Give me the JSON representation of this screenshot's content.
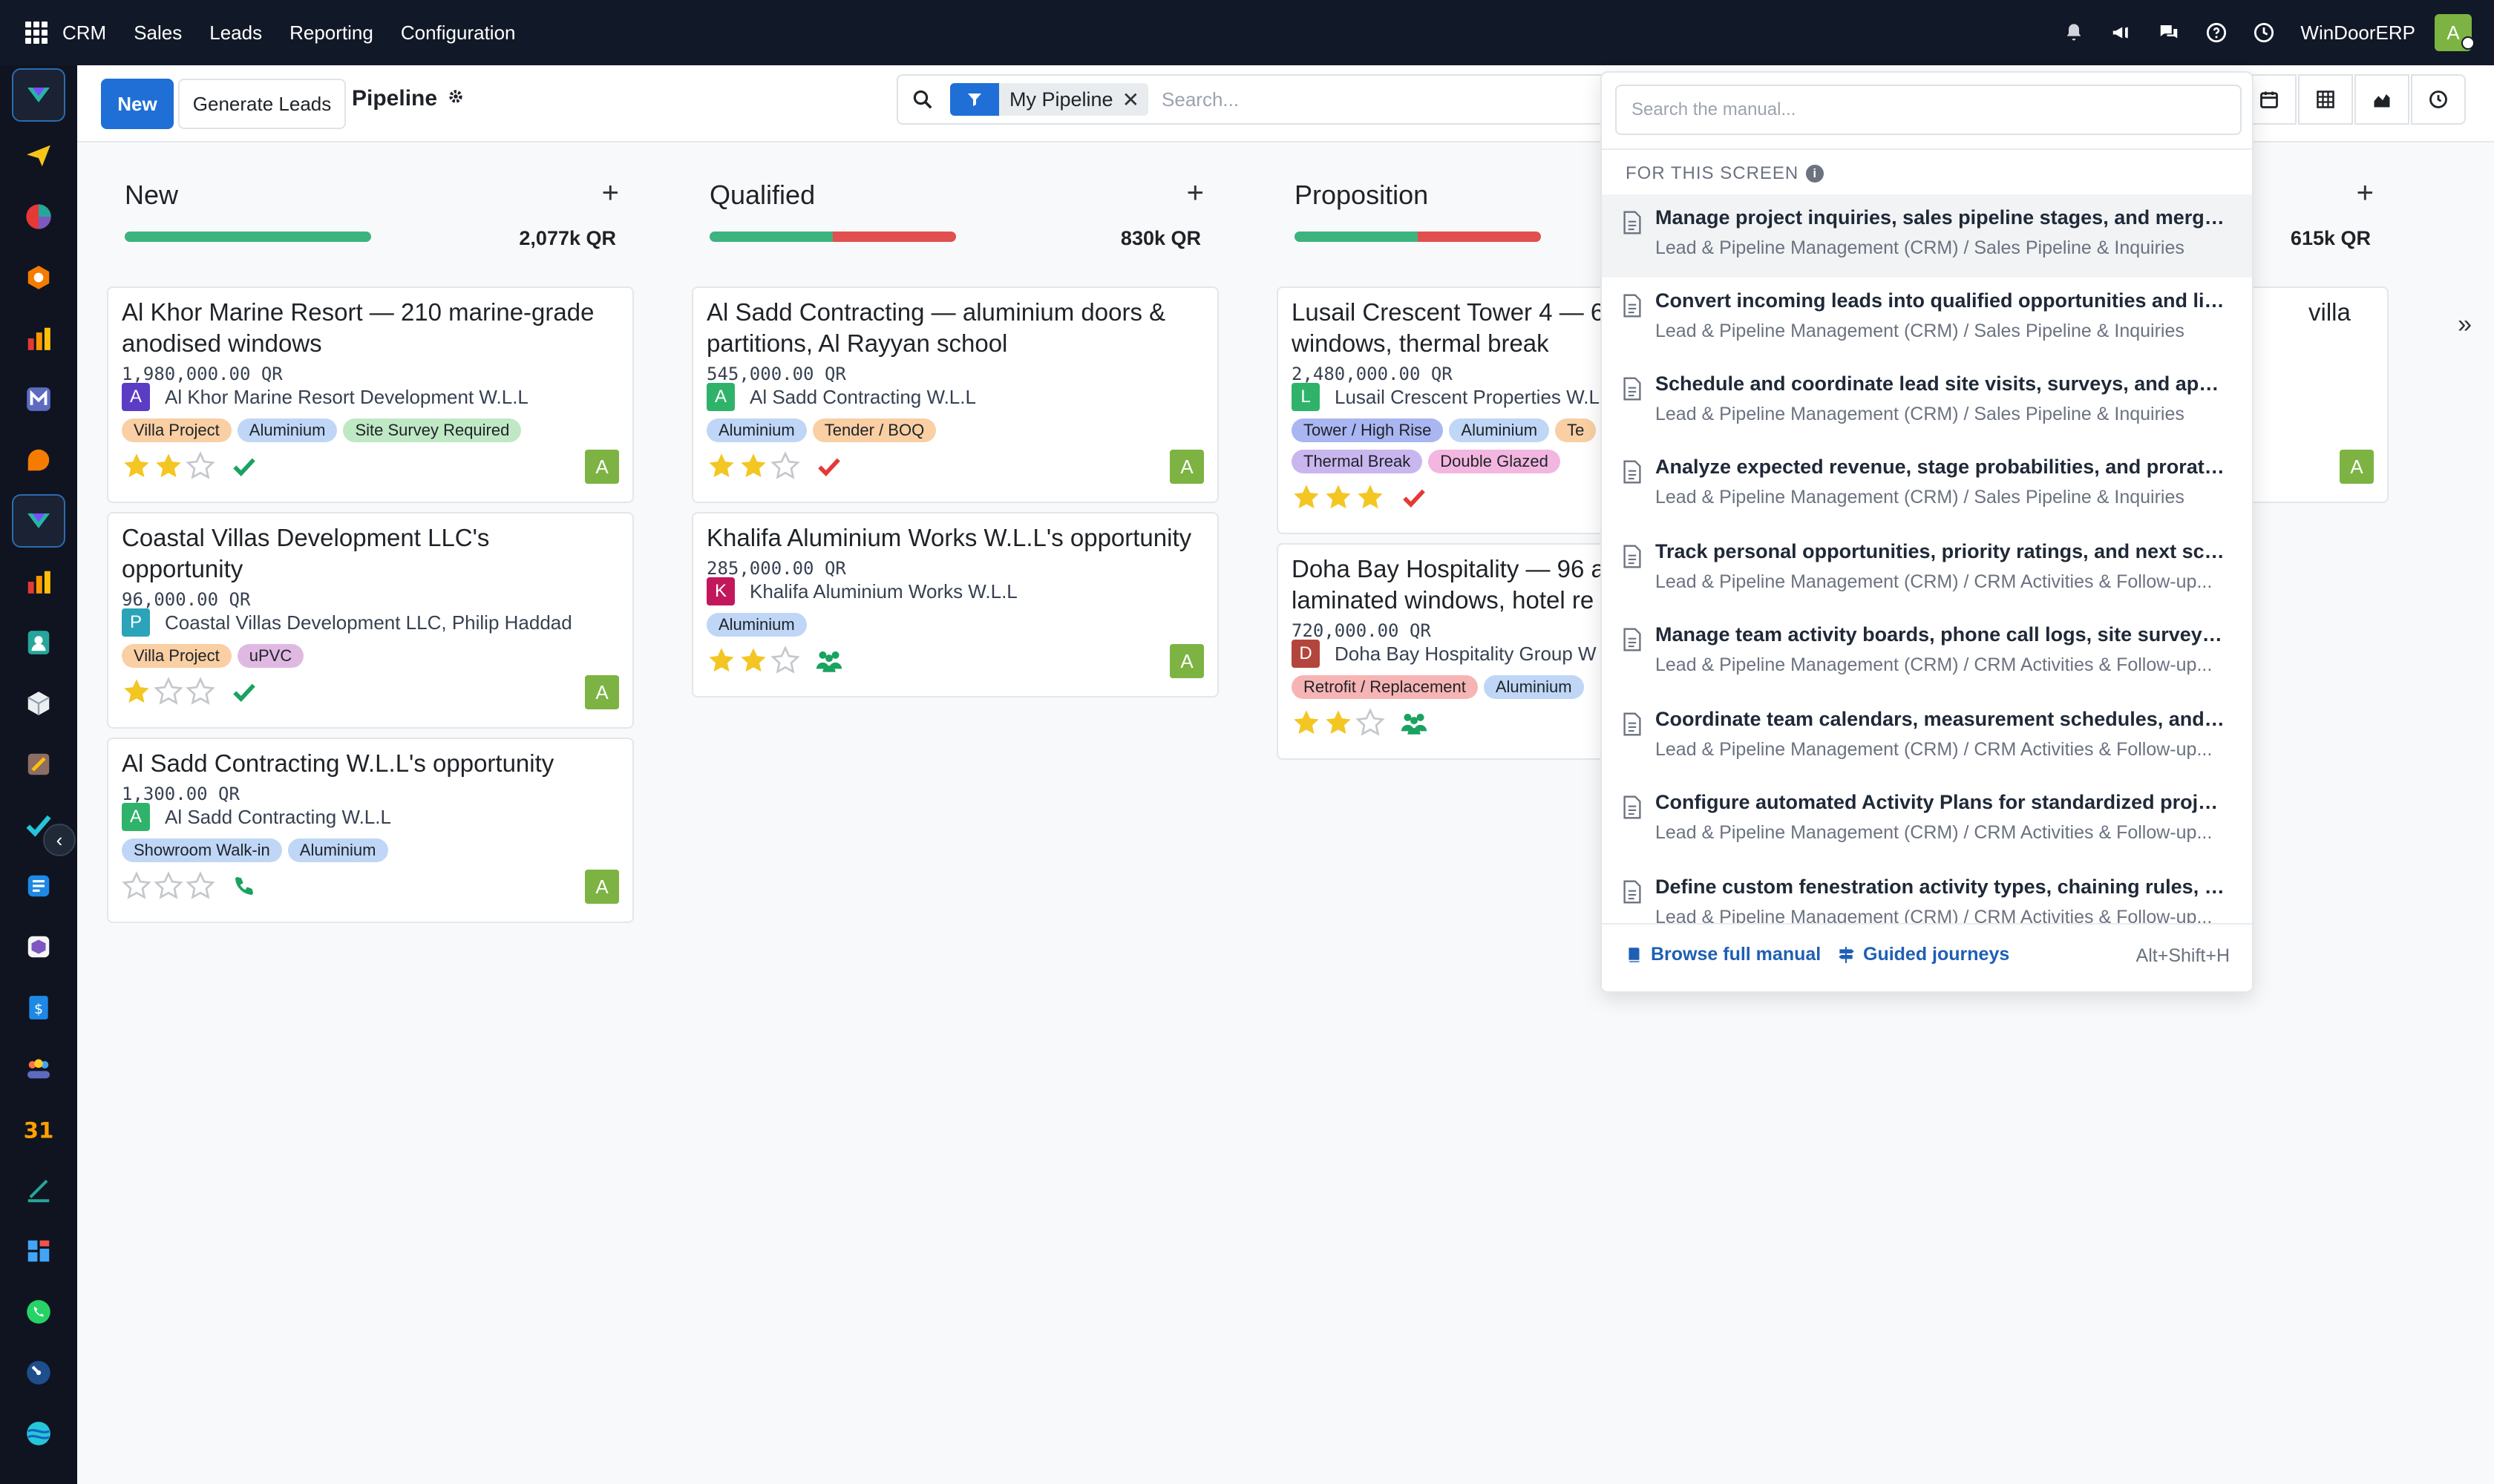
{
  "topbar": {
    "menu": [
      "CRM",
      "Sales",
      "Leads",
      "Reporting",
      "Configuration"
    ],
    "company": "WinDoorERP",
    "user_initial": "A",
    "icons": [
      "bell-icon",
      "megaphone-icon",
      "chat-icon",
      "help-icon",
      "clock-icon"
    ]
  },
  "control": {
    "new_label": "New",
    "generate_label": "Generate Leads",
    "title": "Pipeline",
    "filter_label": "My Pipeline",
    "search_placeholder": "Search..."
  },
  "columns": [
    {
      "name": "New",
      "amount": "2,077k QR",
      "bar": {
        "green": 1.0,
        "red": 0
      },
      "cards": [
        {
          "title": "Al Khor Marine Resort — 210 marine-grade anodised windows",
          "revenue": "1,980,000.00 QR",
          "partner": "Al Khor Marine Resort Development W.L.L",
          "partner_initial": "A",
          "partner_color": "#5b3cc4",
          "tags": [
            {
              "label": "Villa Project",
              "color": "#f9cfa3"
            },
            {
              "label": "Aluminium",
              "color": "#bfd6f6"
            },
            {
              "label": "Site Survey Required",
              "color": "#bfe8c4"
            }
          ],
          "stars": 2,
          "activity": "check-green",
          "avatar": "A"
        },
        {
          "title": "Coastal Villas Development LLC's opportunity",
          "revenue": "96,000.00 QR",
          "partner": "Coastal Villas Development LLC, Philip Haddad",
          "partner_initial": "P",
          "partner_color": "#2ba3b8",
          "tags": [
            {
              "label": "Villa Project",
              "color": "#f9cfa3"
            },
            {
              "label": "uPVC",
              "color": "#e0b9e3"
            }
          ],
          "stars": 1,
          "activity": "check-green",
          "avatar": "A"
        },
        {
          "title": "Al Sadd Contracting W.L.L's opportunity",
          "revenue": "1,300.00 QR",
          "partner": "Al Sadd Contracting W.L.L",
          "partner_initial": "A",
          "partner_color": "#2fb36b",
          "tags": [
            {
              "label": "Showroom Walk-in",
              "color": "#bfd6f6"
            },
            {
              "label": "Aluminium",
              "color": "#bfd6f6"
            }
          ],
          "stars": 0,
          "activity": "phone",
          "avatar": "A"
        }
      ]
    },
    {
      "name": "Qualified",
      "amount": "830k QR",
      "bar": {
        "green": 0.5,
        "red": 0.5
      },
      "cards": [
        {
          "title": "Al Sadd Contracting — aluminium doors & partitions, Al Rayyan school",
          "revenue": "545,000.00 QR",
          "partner": "Al Sadd Contracting W.L.L",
          "partner_initial": "A",
          "partner_color": "#2fb36b",
          "tags": [
            {
              "label": "Aluminium",
              "color": "#bfd6f6"
            },
            {
              "label": "Tender / BOQ",
              "color": "#f9cfa3"
            }
          ],
          "stars": 2,
          "activity": "check-red",
          "avatar": "A"
        },
        {
          "title": "Khalifa Aluminium Works W.L.L's opportunity",
          "revenue": "285,000.00 QR",
          "partner": "Khalifa Aluminium Works W.L.L",
          "partner_initial": "K",
          "partner_color": "#c2185b",
          "tags": [
            {
              "label": "Aluminium",
              "color": "#bfd6f6"
            }
          ],
          "stars": 2,
          "activity": "meeting",
          "avatar": "A"
        }
      ]
    },
    {
      "name": "Proposition",
      "amount": "",
      "bar": {
        "green": 0.5,
        "red": 0.5
      },
      "cards": [
        {
          "title": "Lusail Crescent Tower 4 — 6",
          "title2": "windows, thermal break",
          "revenue": "2,480,000.00 QR",
          "partner": "Lusail Crescent Properties W.L",
          "partner_initial": "L",
          "partner_color": "#2fb36b",
          "tags": [
            {
              "label": "Tower / High Rise",
              "color": "#a9b6f2"
            },
            {
              "label": "Aluminium",
              "color": "#bfd6f6"
            },
            {
              "label": "Te",
              "color": "#f9cfa3"
            },
            {
              "label": "Thermal Break",
              "color": "#c9b6ef"
            },
            {
              "label": "Double Glazed",
              "color": "#f3b6e0"
            }
          ],
          "stars": 3,
          "activity": "check-red",
          "avatar": "A"
        },
        {
          "title": "Doha Bay Hospitality — 96 a",
          "title2": "laminated windows, hotel re",
          "revenue": "720,000.00 QR",
          "partner": "Doha Bay Hospitality Group W",
          "partner_initial": "D",
          "partner_color": "#b4453c",
          "tags": [
            {
              "label": "Retrofit / Replacement",
              "color": "#f7b4b4"
            },
            {
              "label": "Aluminium",
              "color": "#bfd6f6"
            }
          ],
          "stars": 2,
          "activity": "meeting",
          "avatar": "A"
        }
      ]
    },
    {
      "name": "",
      "amount": "615k QR",
      "bar": {
        "green": 0,
        "red": 0
      },
      "cards": [
        {
          "title": "villa",
          "avatar": "A"
        }
      ]
    }
  ],
  "manual": {
    "search_placeholder": "Search the manual...",
    "section": "FOR THIS SCREEN",
    "items": [
      {
        "title": "Manage project inquiries, sales pipeline stages, and merge ...",
        "path": "Lead & Pipeline Management (CRM) / Sales Pipeline & Inquiries"
      },
      {
        "title": "Convert incoming leads into qualified opportunities and link...",
        "path": "Lead & Pipeline Management (CRM) / Sales Pipeline & Inquiries"
      },
      {
        "title": "Schedule and coordinate lead site visits, surveys, and appoi...",
        "path": "Lead & Pipeline Management (CRM) / Sales Pipeline & Inquiries"
      },
      {
        "title": "Analyze expected revenue, stage probabilities, and prorated ...",
        "path": "Lead & Pipeline Management (CRM) / Sales Pipeline & Inquiries"
      },
      {
        "title": "Track personal opportunities, priority ratings, and next sche...",
        "path": "Lead & Pipeline Management (CRM) / CRM Activities & Follow-up..."
      },
      {
        "title": "Manage team activity boards, phone call logs, site survey ta...",
        "path": "Lead & Pipeline Management (CRM) / CRM Activities & Follow-up..."
      },
      {
        "title": "Coordinate team calendars, measurement schedules, and cl...",
        "path": "Lead & Pipeline Management (CRM) / CRM Activities & Follow-up..."
      },
      {
        "title": "Configure automated Activity Plans for standardized project...",
        "path": "Lead & Pipeline Management (CRM) / CRM Activities & Follow-up..."
      },
      {
        "title": "Define custom fenestration activity types, chaining rules, an...",
        "path": "Lead & Pipeline Management (CRM) / CRM Activities & Follow-up..."
      }
    ],
    "browse_label": "Browse full manual",
    "journeys_label": "Guided journeys",
    "shortcut": "Alt+Shift+H"
  },
  "colors": {
    "accent": "#1f6fd6",
    "star": "#f3c623",
    "green": "#1aa260",
    "red": "#e53935",
    "avatar": "#7cb342"
  }
}
